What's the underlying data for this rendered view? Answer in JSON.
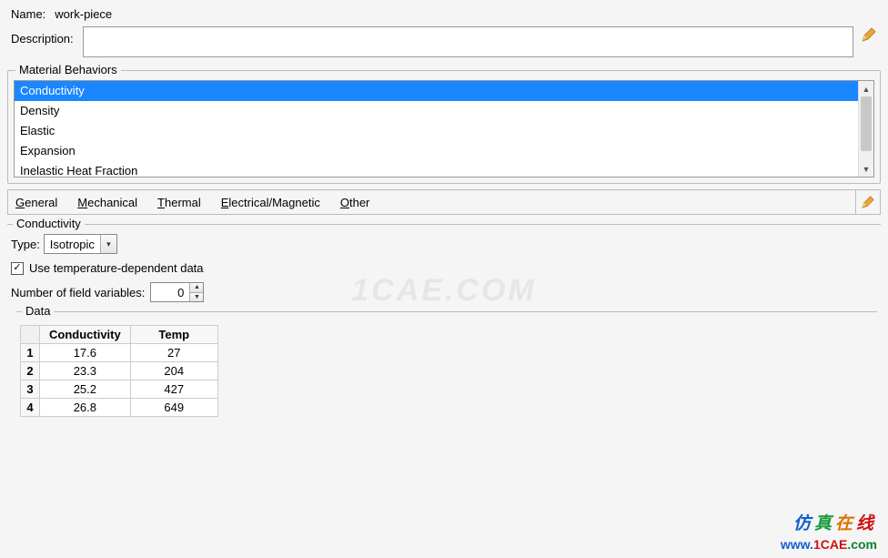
{
  "header": {
    "name_label": "Name:",
    "name_value": "work-piece",
    "description_label": "Description:",
    "description_value": ""
  },
  "behaviors": {
    "legend": "Material Behaviors",
    "items": [
      "Conductivity",
      "Density",
      "Elastic",
      "Expansion",
      "Inelastic Heat Fraction"
    ],
    "selected_index": 0
  },
  "menus": {
    "general": "General",
    "mechanical": "Mechanical",
    "thermal": "Thermal",
    "electrical": "Electrical/Magnetic",
    "other": "Other"
  },
  "conductivity": {
    "title": "Conductivity",
    "type_label": "Type:",
    "type_value": "Isotropic",
    "temp_dep_label": "Use temperature-dependent data",
    "temp_dep_checked": true,
    "nvar_label": "Number of field variables:",
    "nvar_value": "0",
    "data_legend": "Data",
    "columns": [
      "Conductivity",
      "Temp"
    ],
    "rows": [
      {
        "n": "1",
        "c": "17.6",
        "t": "27"
      },
      {
        "n": "2",
        "c": "23.3",
        "t": "204"
      },
      {
        "n": "3",
        "c": "25.2",
        "t": "427"
      },
      {
        "n": "4",
        "c": "26.8",
        "t": "649"
      }
    ]
  },
  "watermark": "1CAE.COM",
  "brand": {
    "cn": "仿真在线",
    "url_w": "www.",
    "url_d": "1CAE",
    "url_c": ".com"
  },
  "glyphs": {
    "check": "✓",
    "down": "▾",
    "up": "▴",
    "tri_down": "▼",
    "tri_up": "▲"
  }
}
